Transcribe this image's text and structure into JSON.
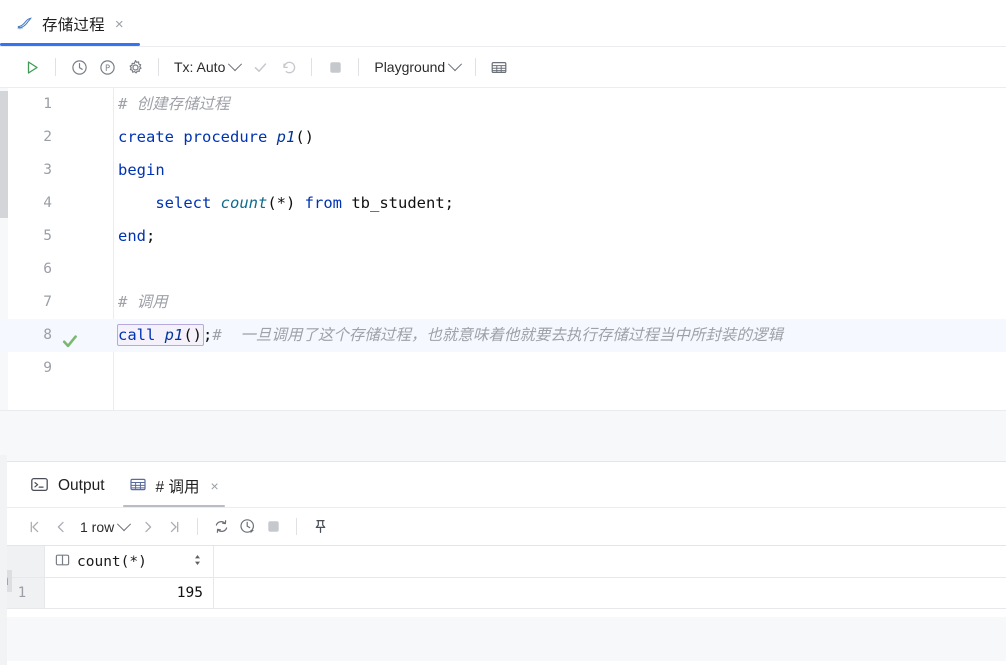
{
  "editor_tab": {
    "title": "存储过程",
    "icon": "mysql-dolphin-icon",
    "close": "×"
  },
  "toolbar": {
    "execute": "▷",
    "history_icon": "clock-icon",
    "profile_icon": "p-circle-icon",
    "settings_icon": "gear-icon",
    "tx_label": "Tx: Auto",
    "commit_icon": "checkmark-icon",
    "rollback_icon": "rollback-icon",
    "stop_icon": "stop-icon",
    "schema_label": "Playground",
    "grid_icon": "table-grid-icon"
  },
  "code": {
    "lines": [
      {
        "n": "1",
        "marker": "",
        "tokens": [
          {
            "t": "# ",
            "c": "cmt-hash"
          },
          {
            "t": "创建存储过程",
            "c": "cmt"
          }
        ]
      },
      {
        "n": "2",
        "marker": "",
        "tokens": [
          {
            "t": "create procedure ",
            "c": "kw"
          },
          {
            "t": "p1",
            "c": "ident"
          },
          {
            "t": "()",
            "c": ""
          }
        ]
      },
      {
        "n": "3",
        "marker": "",
        "tokens": [
          {
            "t": "begin",
            "c": "kw"
          }
        ]
      },
      {
        "n": "4",
        "marker": "",
        "tokens": [
          {
            "t": "    ",
            "c": ""
          },
          {
            "t": "select ",
            "c": "kw"
          },
          {
            "t": "count",
            "c": "fn"
          },
          {
            "t": "(*) ",
            "c": ""
          },
          {
            "t": "from ",
            "c": "kw"
          },
          {
            "t": "tb_student;",
            "c": ""
          }
        ]
      },
      {
        "n": "5",
        "marker": "",
        "tokens": [
          {
            "t": "end",
            "c": "kw"
          },
          {
            "t": ";",
            "c": ""
          }
        ]
      },
      {
        "n": "6",
        "marker": "",
        "tokens": []
      },
      {
        "n": "7",
        "marker": "",
        "tokens": [
          {
            "t": "# ",
            "c": "cmt-hash"
          },
          {
            "t": "调用",
            "c": "cmt"
          }
        ]
      },
      {
        "n": "8",
        "marker": "check",
        "highlight": true,
        "tokens": [
          {
            "t": "call ",
            "c": "kw",
            "sel": "start"
          },
          {
            "t": "p1",
            "c": "ident",
            "sel": "mid"
          },
          {
            "t": "()",
            "c": "",
            "sel": "end"
          },
          {
            "t": ";",
            "c": ""
          },
          {
            "t": "#",
            "c": "cmt-hash"
          },
          {
            "t": "  一旦调用了这个存储过程，也就意味着他就要去执行存储过程当中所封装的逻辑",
            "c": "cmt"
          }
        ]
      },
      {
        "n": "9",
        "marker": "",
        "tokens": []
      }
    ]
  },
  "panel": {
    "tabs": [
      {
        "label": "Output",
        "icon": "terminal-icon",
        "active": false,
        "closable": false
      },
      {
        "label": "# 调用",
        "icon": "table-grid-icon",
        "active": true,
        "closable": true,
        "close": "×"
      }
    ]
  },
  "result_toolbar": {
    "first_page_icon": "first-page-icon",
    "prev_page_icon": "prev-page-icon",
    "row_count": "1 row",
    "next_page_icon": "next-page-icon",
    "last_page_icon": "last-page-icon",
    "refresh_icon": "refresh-icon",
    "schedule_icon": "clock-schedule-icon",
    "stop_icon": "stop-icon",
    "pin_icon": "pin-icon"
  },
  "result_grid": {
    "columns": [
      {
        "name": "count(*)",
        "icon": "column-icon",
        "sort": "⇅"
      }
    ],
    "rows": [
      {
        "num": "1",
        "values": [
          "195"
        ]
      }
    ]
  },
  "colors": {
    "accent": "#3574f0",
    "keyword": "#0033b3",
    "identifier": "#00359b",
    "function": "#0f6c8c",
    "comment": "#9ea1a8",
    "success": "#6aab64",
    "selection_border": "#b6a9dd"
  }
}
